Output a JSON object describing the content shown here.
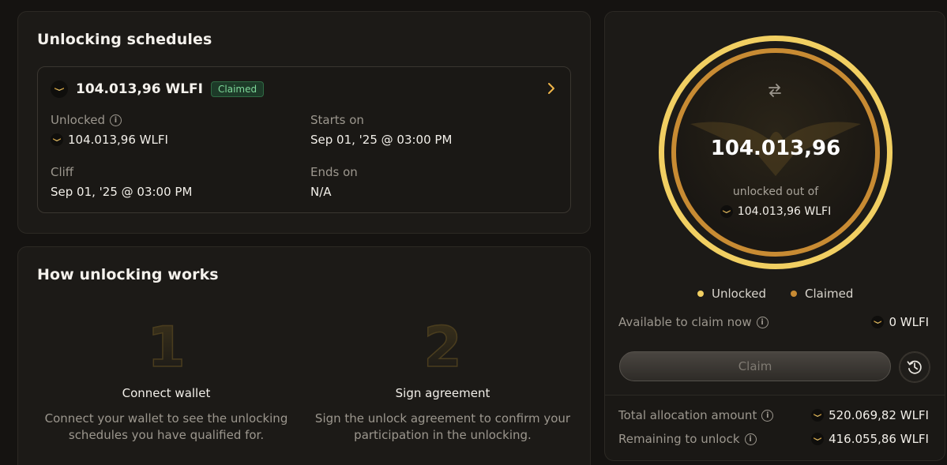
{
  "schedules": {
    "title": "Unlocking schedules",
    "item": {
      "amount": "104.013,96 WLFI",
      "badge": "Claimed",
      "unlocked_label": "Unlocked",
      "unlocked_value": "104.013,96 WLFI",
      "starts_label": "Starts on",
      "starts_value": "Sep 01, '25 @ 03:00 PM",
      "cliff_label": "Cliff",
      "cliff_value": "Sep 01, '25 @ 03:00 PM",
      "ends_label": "Ends on",
      "ends_value": "N/A"
    }
  },
  "how": {
    "title": "How unlocking works",
    "steps": [
      {
        "num": "1",
        "title": "Connect wallet",
        "desc_line1": "Connect your wallet to see the unlocking",
        "desc_line2": "schedules you have qualified for."
      },
      {
        "num": "2",
        "title": "Sign agreement",
        "desc_line1": "Sign the unlock agreement to confirm your",
        "desc_line2": "participation in the unlocking."
      }
    ]
  },
  "summary": {
    "big_number": "104.013,96",
    "sub_text": "unlocked out of",
    "total": "104.013,96 WLFI",
    "legend_unlocked": "Unlocked",
    "legend_claimed": "Claimed",
    "available_label": "Available to claim now",
    "available_value": "0 WLFI",
    "claim_label": "Claim",
    "total_alloc_label": "Total allocation amount",
    "total_alloc_value": "520.069,82 WLFI",
    "remaining_label": "Remaining to unlock",
    "remaining_value": "416.055,86 WLFI"
  },
  "colors": {
    "unlocked": "#f1cf62",
    "claimed": "#c88b33",
    "badge_green": "#7fd89a"
  },
  "icons": [
    "wlfi-token-icon",
    "info-icon",
    "chevron-right-icon",
    "swap-icon",
    "history-icon"
  ]
}
